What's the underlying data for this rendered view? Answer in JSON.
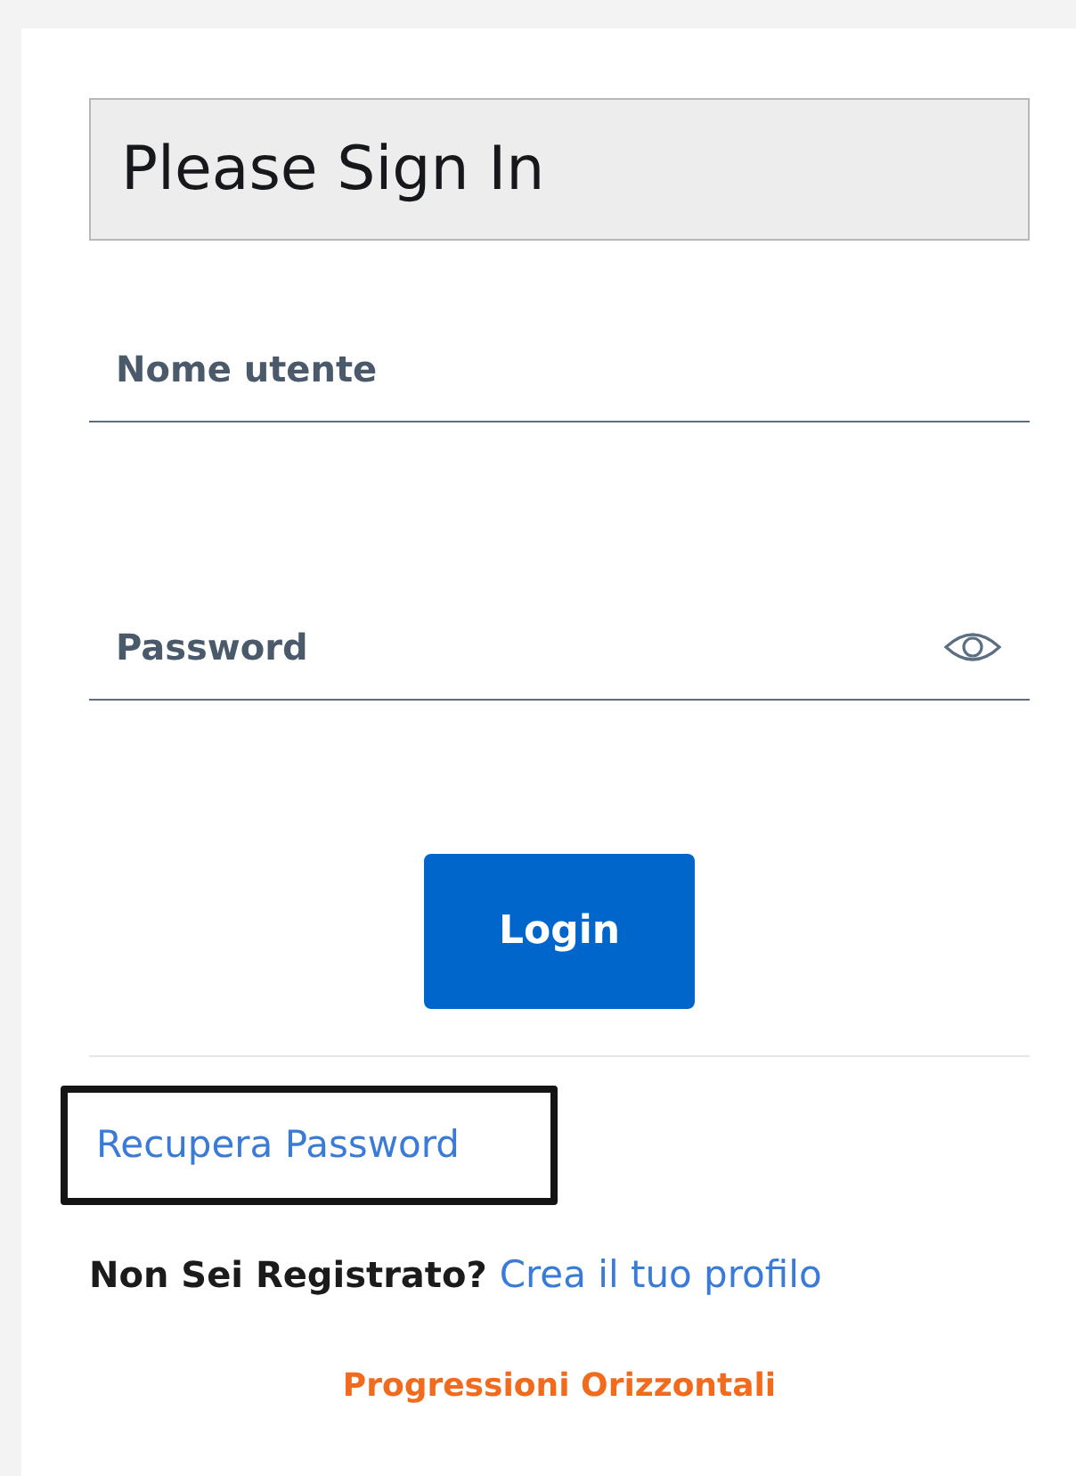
{
  "heading": "Please Sign In",
  "fields": [
    {
      "placeholder": "Nome utente",
      "kind": "text"
    },
    {
      "placeholder": "Password",
      "kind": "password"
    }
  ],
  "login_button": "Login",
  "recover_link": {
    "label": "Recupera Password",
    "focused": true
  },
  "register": {
    "question": "Non Sei Registrato?",
    "link": "Crea il tuo profilo"
  },
  "footer_link": "Progressioni Orizzontali"
}
